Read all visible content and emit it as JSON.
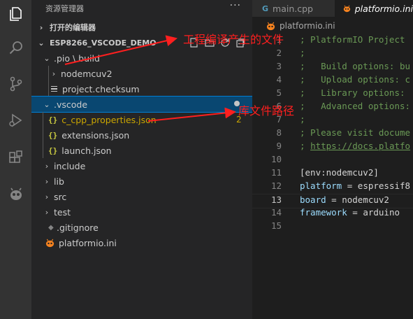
{
  "sidebar": {
    "title": "资源管理器",
    "more": "···",
    "open_editors": "打开的编辑器",
    "project": "ESP8266_VSCODE_DEMO",
    "pio_build": ".pio \\ build",
    "nodemcuv2": "nodemcuv2",
    "project_checksum": "project.checksum",
    "vscode": ".vscode",
    "c_cpp_properties": "c_cpp_properties.json",
    "c_cpp_badge": "2",
    "extensions": "extensions.json",
    "launch": "launch.json",
    "include": "include",
    "lib": "lib",
    "src": "src",
    "test": "test",
    "gitignore": ".gitignore",
    "platformio_ini": "platformio.ini"
  },
  "tabs": {
    "main_cpp": "main.cpp",
    "platformio_ini": "platformio.ini"
  },
  "breadcrumb": "platformio.ini",
  "code": {
    "numbers": [
      "1",
      "2",
      "3",
      "4",
      "5",
      "6",
      "7",
      "8",
      "9",
      "10",
      "11",
      "12",
      "13",
      "14",
      "15"
    ],
    "l1": "; PlatformIO Project",
    "l2": ";",
    "l3": ";   Build options: bu",
    "l4": ";   Upload options: c",
    "l5": ";   Library options:",
    "l6": ";   Advanced options:",
    "l7": ";",
    "l8": "; Please visit docume",
    "l9_prefix": "; ",
    "l9_link": "https://docs.platfo",
    "l10": "",
    "l11": "[env:nodemcuv2]",
    "l12_key": "platform",
    "l12_eq": " = ",
    "l12_val": "espressif8",
    "l13_key": "board",
    "l13_eq": " = ",
    "l13_val": "nodemcuv2",
    "l14_key": "framework",
    "l14_eq": " = ",
    "l14_val": "arduino",
    "l15": ""
  },
  "annotations": {
    "build": "工程编译产生的文件",
    "library": "库文件路径"
  },
  "colors": {
    "accent": "#007fd4",
    "selection": "#094771",
    "annotation": "#ff1f1f",
    "platformio_orange": "#f5821f"
  },
  "icons": [
    "explorer-icon",
    "search-icon",
    "source-control-icon",
    "run-debug-icon",
    "extensions-icon",
    "platformio-icon"
  ]
}
